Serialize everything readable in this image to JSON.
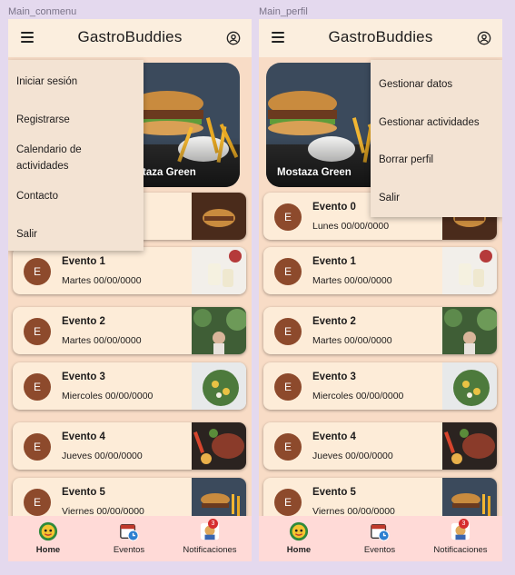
{
  "frames": [
    {
      "label": "Main_conmenu",
      "menu": [
        "Iniciar sesión",
        "Registrarse",
        "Calendario de actividades",
        "Contacto",
        "Salir"
      ]
    },
    {
      "label": "Main_perfil",
      "menu": [
        "Gestionar datos",
        "Gestionar actividades",
        "Borrar perfil",
        "Salir"
      ]
    }
  ],
  "app": {
    "title": "GastroBuddies"
  },
  "hero": {
    "label": "Mostaza Green"
  },
  "events": [
    {
      "avatar": "E",
      "title": "Evento 0",
      "date": "Lunes 00/00/0000"
    },
    {
      "avatar": "E",
      "title": "Evento 1",
      "date": "Martes 00/00/0000"
    },
    {
      "avatar": "E",
      "title": "Evento 2",
      "date": "Martes 00/00/0000"
    },
    {
      "avatar": "E",
      "title": "Evento 3",
      "date": "Miercoles 00/00/0000"
    },
    {
      "avatar": "E",
      "title": "Evento 4",
      "date": "Jueves 00/00/0000"
    },
    {
      "avatar": "E",
      "title": "Evento 5",
      "date": "Viernes 00/00/0000"
    }
  ],
  "nav": {
    "home": "Home",
    "events": "Eventos",
    "notifications": "Notificaciones",
    "badge": "3"
  },
  "icons": [
    "menu-icon",
    "account-circle-icon",
    "home-icon",
    "calendar-clock-icon",
    "notifications-icon"
  ],
  "colors": {
    "background": "#e4d9ee",
    "topbar": "#fbeede",
    "body": "#f8dcc6",
    "card": "#fdecd8",
    "avatar": "#8d4a2c",
    "nav": "#ffdad7",
    "menu": "#f3e3d3"
  }
}
